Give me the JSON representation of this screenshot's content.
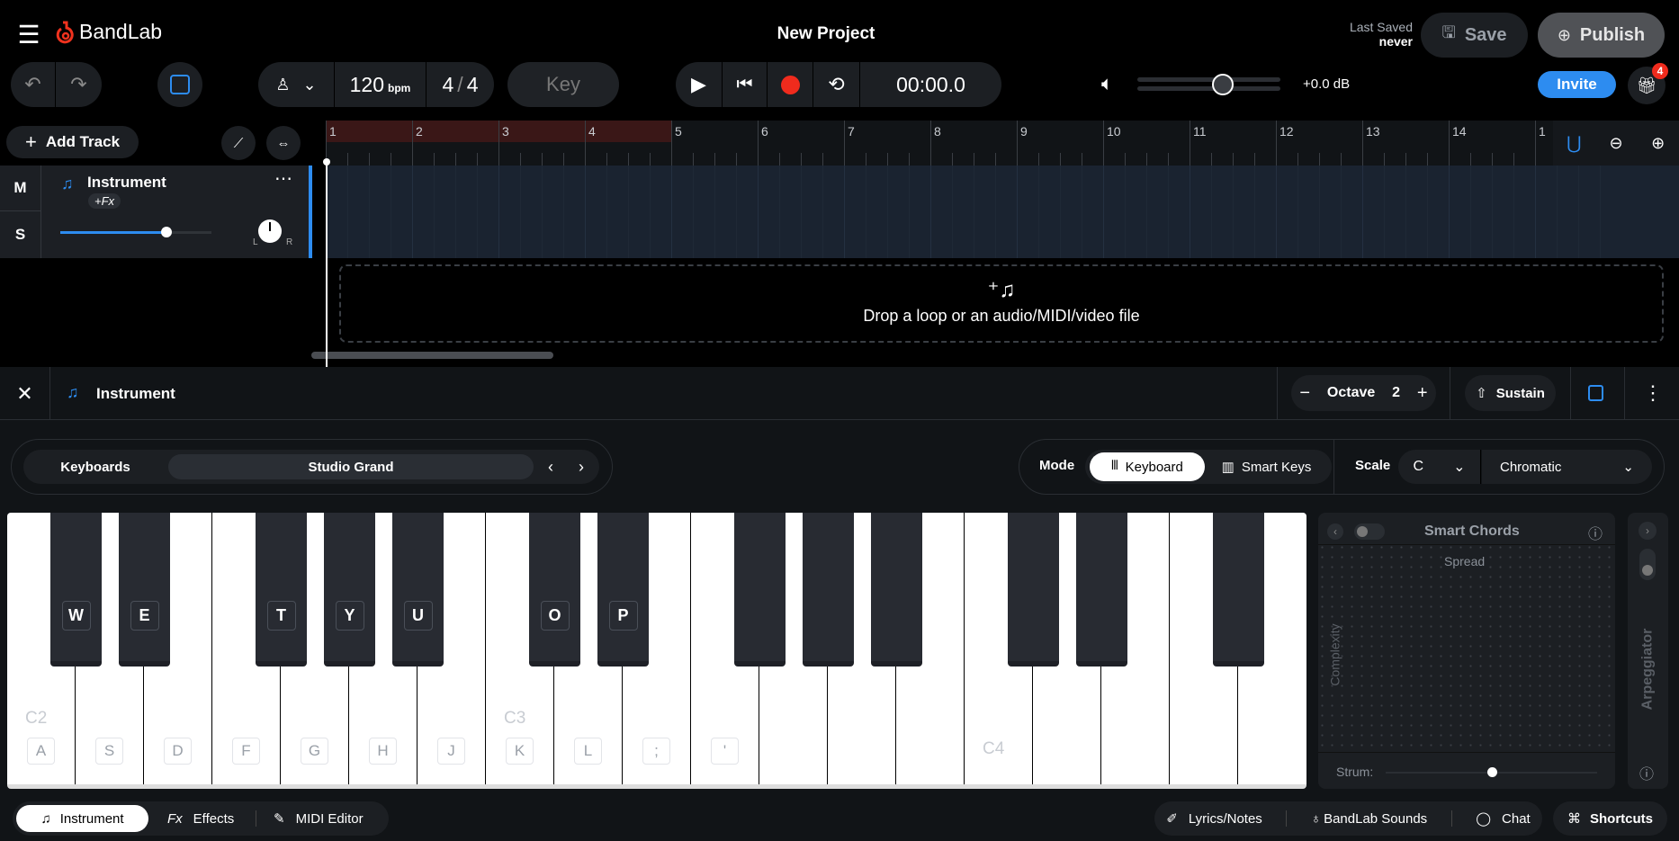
{
  "app": {
    "brand": "BandLab",
    "project_title": "New Project",
    "last_saved_label": "Last Saved",
    "last_saved_value": "never",
    "save": "Save",
    "publish": "Publish",
    "invite": "Invite",
    "gift_badge": "4"
  },
  "toolbar": {
    "tempo": "120",
    "tempo_unit": "bpm",
    "time_sig_num": "4",
    "time_sig_den": "4",
    "key": "Key",
    "time": "00:00.0",
    "volume_db": "+0.0 dB",
    "volume_level": 0.6
  },
  "tracks_header": {
    "add_track": "Add Track",
    "ruler": [
      "1",
      "2",
      "3",
      "4",
      "5",
      "6",
      "7",
      "8",
      "9",
      "10",
      "11",
      "12",
      "13",
      "14",
      "1"
    ]
  },
  "track": {
    "mute": "M",
    "solo": "S",
    "name": "Instrument",
    "fx": "+Fx",
    "pan_l": "L",
    "pan_r": "R",
    "volume_level": 0.7
  },
  "dropzone": {
    "text": "Drop a loop or an audio/MIDI/video file"
  },
  "panel": {
    "title": "Instrument",
    "octave_label": "Octave",
    "octave_value": "2",
    "sustain": "Sustain",
    "category": "Keyboards",
    "preset": "Studio Grand",
    "mode_label": "Mode",
    "mode_keyboard": "Keyboard",
    "mode_smart_keys": "Smart Keys",
    "scale_label": "Scale",
    "scale_root": "C",
    "scale_type": "Chromatic"
  },
  "piano": {
    "white_notes": [
      "C2",
      "",
      "",
      "",
      "",
      "",
      "",
      "C3",
      "",
      "",
      "",
      "",
      "",
      "",
      "C4",
      "",
      "",
      "",
      ""
    ],
    "white_keys": [
      "A",
      "S",
      "D",
      "F",
      "G",
      "H",
      "J",
      "K",
      "L",
      ";",
      "'",
      "",
      "",
      "",
      "",
      "",
      "",
      "",
      ""
    ],
    "black_keys": [
      {
        "after": 0,
        "key": "W"
      },
      {
        "after": 1,
        "key": "E"
      },
      {
        "after": 3,
        "key": "T"
      },
      {
        "after": 4,
        "key": "Y"
      },
      {
        "after": 5,
        "key": "U"
      },
      {
        "after": 7,
        "key": "O"
      },
      {
        "after": 8,
        "key": "P"
      },
      {
        "after": 10,
        "key": ""
      },
      {
        "after": 11,
        "key": ""
      },
      {
        "after": 12,
        "key": ""
      },
      {
        "after": 14,
        "key": ""
      },
      {
        "after": 15,
        "key": ""
      },
      {
        "after": 17,
        "key": ""
      }
    ]
  },
  "smart_chords": {
    "title": "Smart Chords",
    "spread": "Spread",
    "complexity": "Complexity",
    "strum": "Strum:",
    "strum_level": 0.5,
    "arpeggiator": "Arpeggiator"
  },
  "bottom": {
    "instrument": "Instrument",
    "effects": "Effects",
    "fx_icon": "Fx",
    "midi_editor": "MIDI Editor",
    "lyrics": "Lyrics/Notes",
    "sounds": "BandLab Sounds",
    "chat": "Chat",
    "shortcuts": "Shortcuts"
  },
  "colors": {
    "accent": "#2d8cf0",
    "record": "#f02b1d",
    "brand": "#f0321e",
    "region": "#3a1717",
    "lane": "#1a2330"
  }
}
